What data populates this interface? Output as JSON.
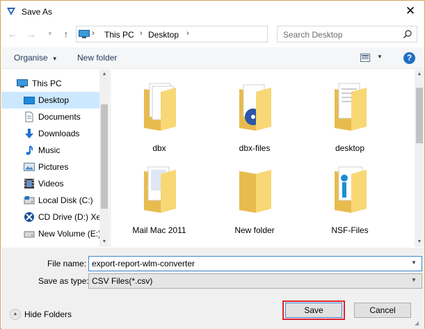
{
  "window": {
    "title": "Save As"
  },
  "nav": {
    "breadcrumb": [
      "This PC",
      "Desktop"
    ],
    "search_placeholder": "Search Desktop"
  },
  "toolbar": {
    "organise_label": "Organise",
    "new_folder_label": "New folder",
    "help_label": "?"
  },
  "sidebar": {
    "items": [
      {
        "label": "This PC",
        "icon": "pc-icon"
      },
      {
        "label": "Desktop",
        "icon": "desktop-icon",
        "selected": true
      },
      {
        "label": "Documents",
        "icon": "documents-icon"
      },
      {
        "label": "Downloads",
        "icon": "downloads-icon"
      },
      {
        "label": "Music",
        "icon": "music-icon"
      },
      {
        "label": "Pictures",
        "icon": "pictures-icon"
      },
      {
        "label": "Videos",
        "icon": "videos-icon"
      },
      {
        "label": "Local Disk (C:)",
        "icon": "local-disk-icon"
      },
      {
        "label": "CD Drive (D:) Xe",
        "icon": "cd-drive-icon"
      },
      {
        "label": "New Volume (E:)",
        "icon": "new-volume-icon"
      }
    ]
  },
  "files": [
    {
      "name": "dbx",
      "icon": "folder-docs-icon"
    },
    {
      "name": "dbx-files",
      "icon": "folder-disc-icon"
    },
    {
      "name": "desktop",
      "icon": "folder-docs-icon"
    },
    {
      "name": "Mail Mac 2011",
      "icon": "folder-docs-icon"
    },
    {
      "name": "New folder",
      "icon": "folder-icon"
    },
    {
      "name": "NSF-Files",
      "icon": "folder-app-icon"
    }
  ],
  "form": {
    "filename_label": "File name:",
    "filename_value": "export-report-wlm-converter",
    "type_label": "Save as type:",
    "type_value": "CSV Files(*.csv)",
    "hide_folders_label": "Hide Folders",
    "save_label": "Save",
    "cancel_label": "Cancel"
  },
  "colors": {
    "selection": "#cce8ff",
    "highlight": "#e0232f",
    "folder": "#f8d775"
  }
}
